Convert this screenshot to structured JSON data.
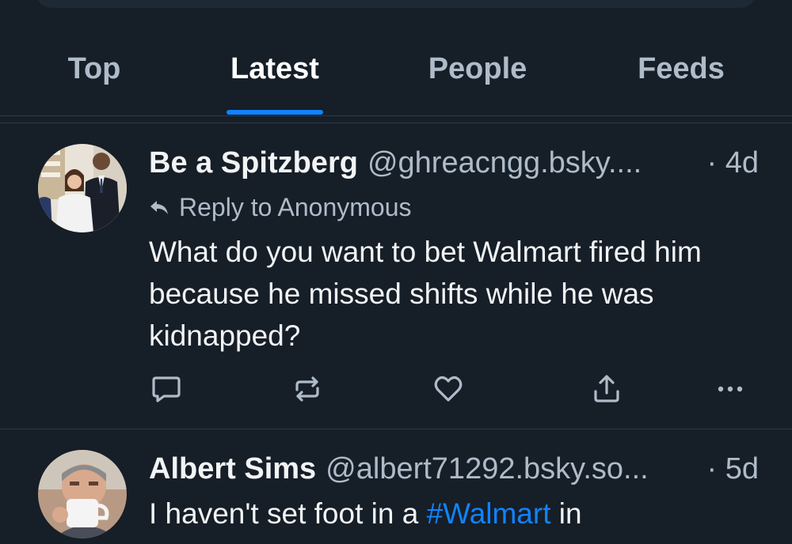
{
  "tabs": [
    {
      "label": "Top",
      "active": false
    },
    {
      "label": "Latest",
      "active": true
    },
    {
      "label": "People",
      "active": false
    },
    {
      "label": "Feeds",
      "active": false
    }
  ],
  "posts": [
    {
      "display_name": "Be a Spitzberg",
      "handle": "@ghreacngg.bsky....",
      "time": "· 4d",
      "reply_to": "Reply to Anonymous",
      "text": "What do you want to bet Walmart fired him because he missed shifts while he was kidnapped?"
    },
    {
      "display_name": "Albert Sims",
      "handle": "@albert71292.bsky.so...",
      "time": "· 5d",
      "text_prefix": "I haven't set foot in a ",
      "hashtag": "#Walmart",
      "text_suffix": " in"
    }
  ],
  "colors": {
    "background": "#161e27",
    "accent": "#1083fe",
    "secondary_text": "#aebbc9",
    "divider": "#2e3a48"
  },
  "icons": {
    "reply": "speech-bubble-icon",
    "repost": "repost-arrows-icon",
    "like": "heart-icon",
    "share": "share-upload-icon",
    "more": "ellipsis-icon",
    "reply_to": "reply-arrow-icon"
  }
}
